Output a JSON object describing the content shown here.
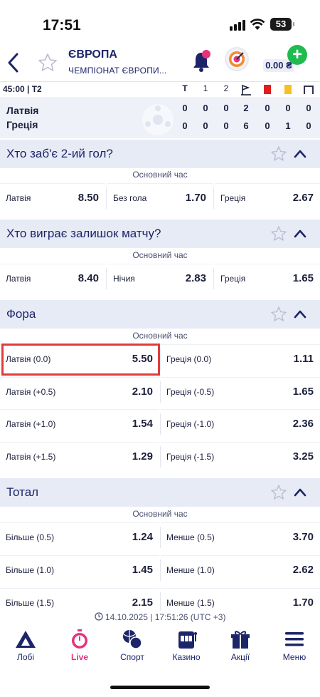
{
  "status_bar": {
    "time": "17:51",
    "battery": "53"
  },
  "header": {
    "league_title": "ЄВРОПА",
    "league_subtitle": "ЧЕМПІОНАТ ЄВРОПИ...",
    "balance": "0.00 ₴",
    "plus": "+"
  },
  "scoreboard": {
    "time": "45:00 | Т2",
    "columns": [
      "Т",
      "1",
      "2"
    ],
    "teams": [
      {
        "name": "Латвія",
        "total": "0",
        "p1": "0",
        "p2": "0",
        "corners": "2",
        "red": "0",
        "yellow": "0",
        "goalkicks": "0"
      },
      {
        "name": "Греція",
        "total": "0",
        "p1": "0",
        "p2": "0",
        "corners": "6",
        "red": "0",
        "yellow": "1",
        "goalkicks": "0"
      }
    ]
  },
  "markets": [
    {
      "title": "Хто заб'є 2-ий гол?",
      "period": "Основний час",
      "odds": [
        {
          "label": "Латвія",
          "value": "8.50"
        },
        {
          "label": "Без гола",
          "value": "1.70"
        },
        {
          "label": "Греція",
          "value": "2.67"
        }
      ]
    },
    {
      "title": "Хто виграє залишок матчу?",
      "period": "Основний час",
      "odds": [
        {
          "label": "Латвія",
          "value": "8.40"
        },
        {
          "label": "Нічия",
          "value": "2.83"
        },
        {
          "label": "Греція",
          "value": "1.65"
        }
      ]
    },
    {
      "title": "Фора",
      "period": "Основний час",
      "rows": [
        [
          {
            "label": "Латвія (0.0)",
            "value": "5.50"
          },
          {
            "label": "Греція (0.0)",
            "value": "1.11"
          }
        ],
        [
          {
            "label": "Латвія (+0.5)",
            "value": "2.10"
          },
          {
            "label": "Греція (-0.5)",
            "value": "1.65"
          }
        ],
        [
          {
            "label": "Латвія (+1.0)",
            "value": "1.54"
          },
          {
            "label": "Греція (-1.0)",
            "value": "2.36"
          }
        ],
        [
          {
            "label": "Латвія (+1.5)",
            "value": "1.29"
          },
          {
            "label": "Греція (-1.5)",
            "value": "3.25"
          }
        ]
      ]
    },
    {
      "title": "Тотал",
      "period": "Основний час",
      "rows": [
        [
          {
            "label": "Більше (0.5)",
            "value": "1.24"
          },
          {
            "label": "Менше (0.5)",
            "value": "3.70"
          }
        ],
        [
          {
            "label": "Більше (1.0)",
            "value": "1.45"
          },
          {
            "label": "Менше (1.0)",
            "value": "2.62"
          }
        ],
        [
          {
            "label": "Більше (1.5)",
            "value": "2.15"
          },
          {
            "label": "Менше (1.5)",
            "value": "1.70"
          }
        ]
      ]
    }
  ],
  "timestamp": "14.10.2025 | 17:51:26 (UTC +3)",
  "bottom_nav": [
    {
      "label": "Лобі",
      "icon": "lobby-icon"
    },
    {
      "label": "Live",
      "icon": "stopwatch-icon",
      "active": true
    },
    {
      "label": "Спорт",
      "icon": "sport-balls-icon"
    },
    {
      "label": "Казино",
      "icon": "slot-machine-icon"
    },
    {
      "label": "Акції",
      "icon": "gift-icon"
    },
    {
      "label": "Меню",
      "icon": "menu-icon"
    }
  ],
  "colors": {
    "accent": "#e8317b",
    "navy": "#1d2569",
    "green": "#1fbb4f",
    "highlight": "#e03c3c"
  }
}
